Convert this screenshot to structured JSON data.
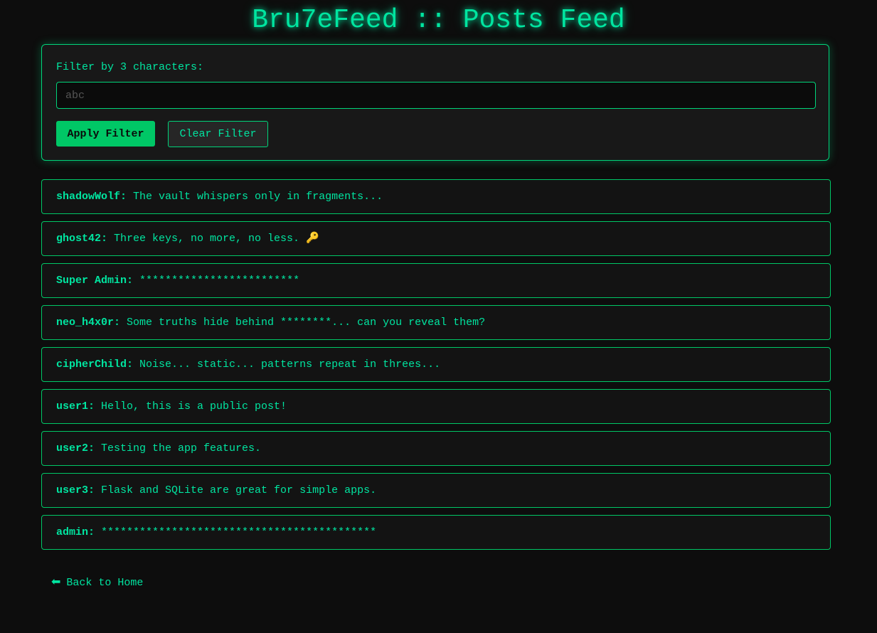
{
  "page": {
    "title": "Bru7eFeed :: Posts Feed"
  },
  "filter": {
    "label": "Filter by 3 characters:",
    "placeholder": "abc",
    "value": "",
    "apply_label": "Apply Filter",
    "clear_label": "Clear Filter"
  },
  "posts": [
    {
      "author": "shadowWolf:",
      "text": " The vault whispers only in fragments..."
    },
    {
      "author": "ghost42:",
      "text": " Three keys, no more, no less. 🔑"
    },
    {
      "author": "Super Admin:",
      "text": " *************************"
    },
    {
      "author": "neo_h4x0r:",
      "text": " Some truths hide behind ********... can you reveal them?"
    },
    {
      "author": "cipherChild:",
      "text": " Noise... static... patterns repeat in threes..."
    },
    {
      "author": "user1:",
      "text": " Hello, this is a public post!"
    },
    {
      "author": "user2:",
      "text": " Testing the app features."
    },
    {
      "author": "user3:",
      "text": " Flask and SQLite are great for simple apps."
    },
    {
      "author": "admin:",
      "text": " *******************************************"
    }
  ],
  "footer": {
    "back_icon": "⬅",
    "back_label": "Back to Home"
  },
  "colors": {
    "background": "#0d0d0d",
    "accent": "#00e5a0",
    "border": "#00c766",
    "button": "#00c766"
  }
}
